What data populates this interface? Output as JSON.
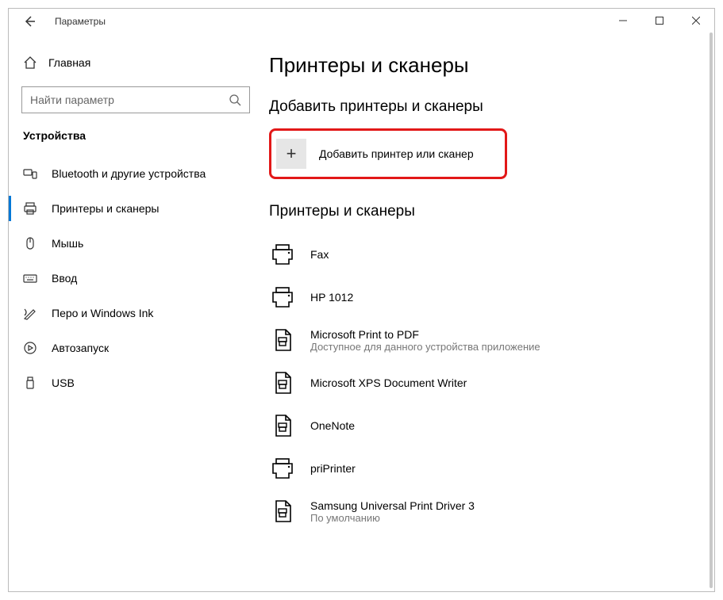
{
  "window": {
    "title": "Параметры"
  },
  "sidebar": {
    "home": "Главная",
    "search_placeholder": "Найти параметр",
    "section": "Устройства",
    "items": [
      {
        "label": "Bluetooth и другие устройства"
      },
      {
        "label": "Принтеры и сканеры"
      },
      {
        "label": "Мышь"
      },
      {
        "label": "Ввод"
      },
      {
        "label": "Перо и Windows Ink"
      },
      {
        "label": "Автозапуск"
      },
      {
        "label": "USB"
      }
    ]
  },
  "main": {
    "title": "Принтеры и сканеры",
    "add_section": "Добавить принтеры и сканеры",
    "add_button": "Добавить принтер или сканер",
    "list_section": "Принтеры и сканеры",
    "printers": [
      {
        "name": "Fax",
        "sub": ""
      },
      {
        "name": "HP 1012",
        "sub": ""
      },
      {
        "name": "Microsoft Print to PDF",
        "sub": "Доступное для данного устройства приложение"
      },
      {
        "name": "Microsoft XPS Document Writer",
        "sub": ""
      },
      {
        "name": "OneNote",
        "sub": ""
      },
      {
        "name": "priPrinter",
        "sub": ""
      },
      {
        "name": "Samsung Universal Print Driver 3",
        "sub": "По умолчанию"
      }
    ]
  }
}
